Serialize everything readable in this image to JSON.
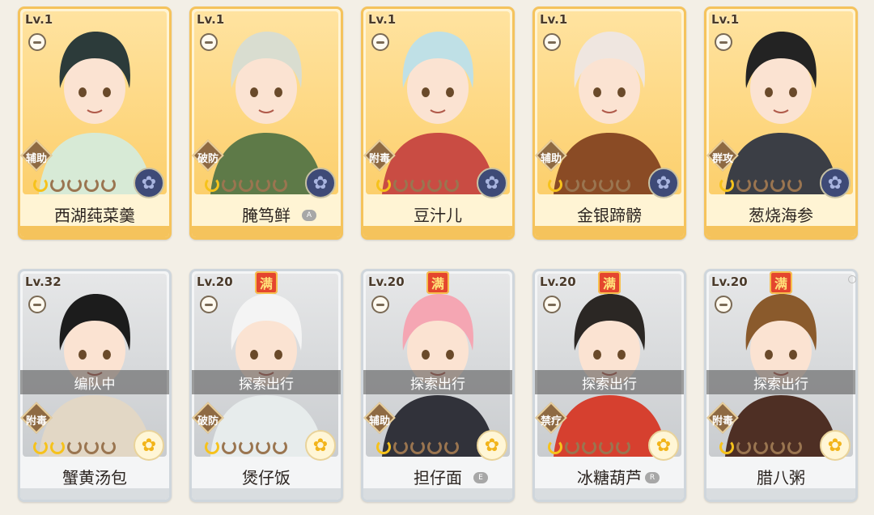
{
  "cards": [
    {
      "level": "Lv.1",
      "name": "西湖莼菜羹",
      "role": "辅助",
      "stars": 1,
      "emblem": "blue",
      "full": false,
      "status": "",
      "tag": "",
      "theme": "gold",
      "hair": "#2c3b3a",
      "outfit": "#d7ead6"
    },
    {
      "level": "Lv.1",
      "name": "腌笃鲜",
      "role": "破防",
      "stars": 1,
      "emblem": "blue",
      "full": false,
      "status": "",
      "tag": "A",
      "theme": "gold",
      "hair": "#d9ddd0",
      "outfit": "#5e7a48"
    },
    {
      "level": "Lv.1",
      "name": "豆汁儿",
      "role": "附毒",
      "stars": 1,
      "emblem": "blue",
      "full": false,
      "status": "",
      "tag": "",
      "theme": "gold",
      "hair": "#bfe0e6",
      "outfit": "#c94c43"
    },
    {
      "level": "Lv.1",
      "name": "金银蹄髈",
      "role": "辅助",
      "stars": 1,
      "emblem": "blue",
      "full": false,
      "status": "",
      "tag": "",
      "theme": "gold",
      "hair": "#efe6e0",
      "outfit": "#8a4b25"
    },
    {
      "level": "Lv.1",
      "name": "葱烧海参",
      "role": "群攻",
      "stars": 1,
      "emblem": "blue",
      "full": false,
      "status": "",
      "tag": "",
      "theme": "gold",
      "hair": "#232323",
      "outfit": "#3b3e45"
    },
    {
      "level": "Lv.32",
      "name": "蟹黄汤包",
      "role": "附毒",
      "stars": 2,
      "emblem": "yellow",
      "full": false,
      "status": "编队中",
      "tag": "",
      "theme": "silver",
      "hair": "#1c1c1c",
      "outfit": "#e2d7c5"
    },
    {
      "level": "Lv.20",
      "name": "煲仔饭",
      "role": "破防",
      "stars": 1,
      "emblem": "yellow",
      "full": true,
      "status": "探索出行",
      "tag": "",
      "theme": "silver",
      "hair": "#f4f4f4",
      "outfit": "#e7ecec"
    },
    {
      "level": "Lv.20",
      "name": "担仔面",
      "role": "辅助",
      "stars": 1,
      "emblem": "yellow",
      "full": true,
      "status": "探索出行",
      "tag": "E",
      "theme": "silver",
      "hair": "#f5a6b3",
      "outfit": "#31323a"
    },
    {
      "level": "Lv.20",
      "name": "冰糖葫芦",
      "role": "禁疗",
      "stars": 1,
      "emblem": "yellow",
      "full": true,
      "status": "探索出行",
      "tag": "R",
      "theme": "silver",
      "hair": "#2b2724",
      "outfit": "#d6402f"
    },
    {
      "level": "Lv.20",
      "name": "腊八粥",
      "role": "附毒",
      "stars": 1,
      "emblem": "yellow",
      "full": true,
      "status": "探索出行",
      "tag": "",
      "theme": "silver",
      "hair": "#8a5a2c",
      "outfit": "#4e2f24"
    }
  ],
  "full_label": "满",
  "colors": {
    "gold_border": "#f5c35c",
    "silver_border": "#cfd6dc",
    "star_on": "#f6c21b",
    "star_off": "#9a7550"
  }
}
